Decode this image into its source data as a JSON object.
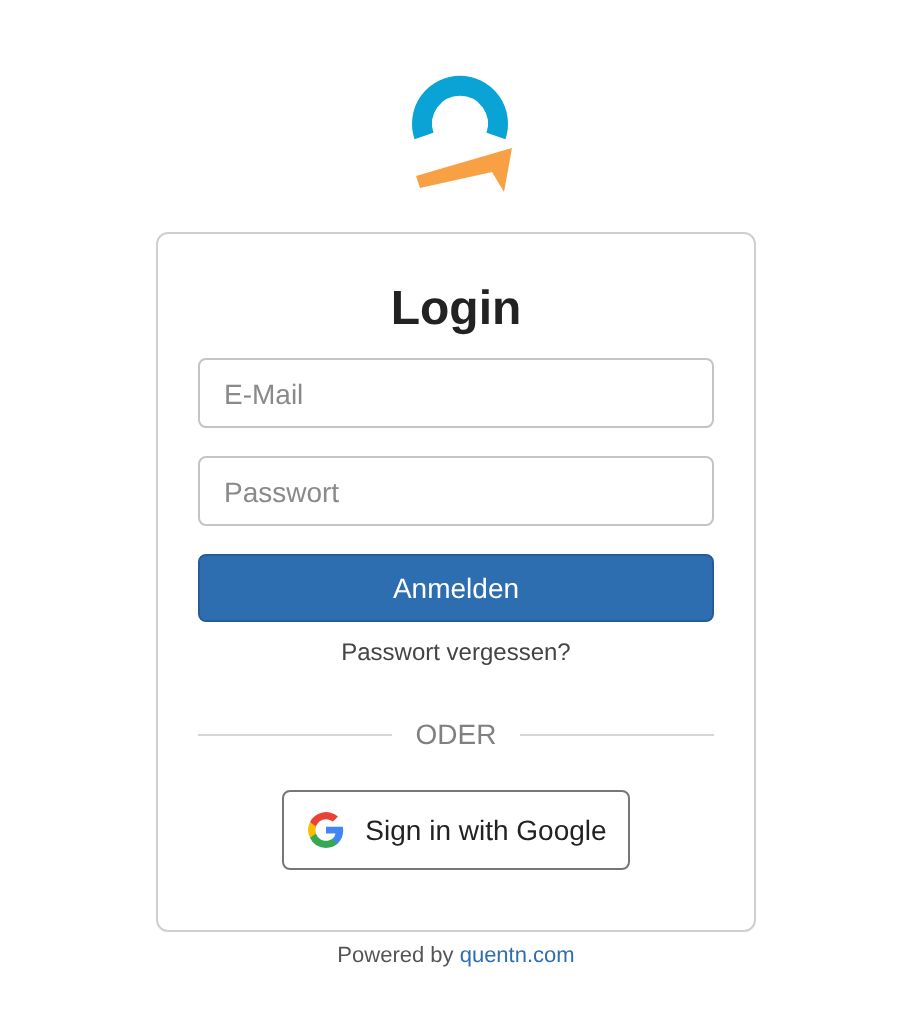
{
  "login_card": {
    "title": "Login",
    "fields": [
      {
        "placeholder": "E-Mail"
      },
      {
        "placeholder": "Passwort"
      }
    ],
    "submit_button": "Anmelden",
    "forgot_link": "Passwort vergessen?",
    "divider_label": "ODER",
    "google_button": "Sign in with Google"
  },
  "footer": {
    "text": "Powered by",
    "link": "quentn.com"
  }
}
